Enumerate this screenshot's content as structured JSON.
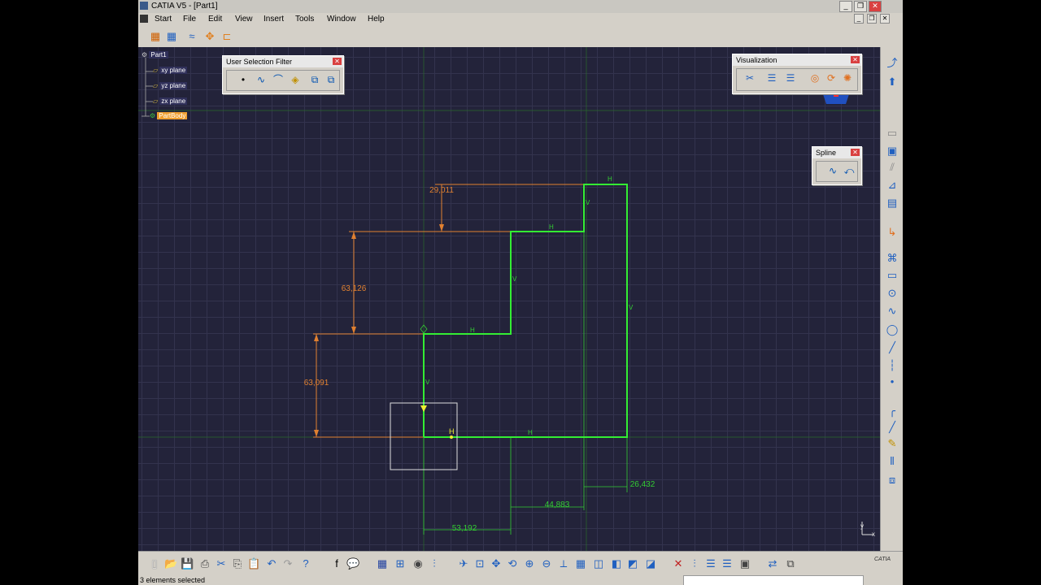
{
  "window": {
    "title": "CATIA V5 - [Part1]"
  },
  "menu": {
    "items": [
      "Start",
      "File",
      "Edit",
      "View",
      "Insert",
      "Tools",
      "Window",
      "Help"
    ]
  },
  "tree": {
    "root": "Part1",
    "items": [
      "xy plane",
      "yz plane",
      "zx plane"
    ],
    "body": "PartBody"
  },
  "panels": {
    "selection_filter": {
      "title": "User Selection Filter"
    },
    "visualization": {
      "title": "Visualization"
    },
    "spline": {
      "title": "Spline"
    }
  },
  "sketch": {
    "dimensions": {
      "top_offset": "29,011",
      "mid_height": "63,126",
      "low_height": "63,091",
      "width_1": "53,192",
      "width_2": "44,883",
      "width_3": "26,432"
    },
    "constraint_h": "H",
    "constraint_v": "V",
    "colors": {
      "geometry": "#33cc33",
      "dimension": "#e08030",
      "grid": "#33334e",
      "background": "#23233a"
    }
  },
  "axis": {
    "x": "x",
    "y": "y"
  },
  "status": {
    "text": "3 elements selected"
  },
  "brand": {
    "logo": "CATIA"
  }
}
